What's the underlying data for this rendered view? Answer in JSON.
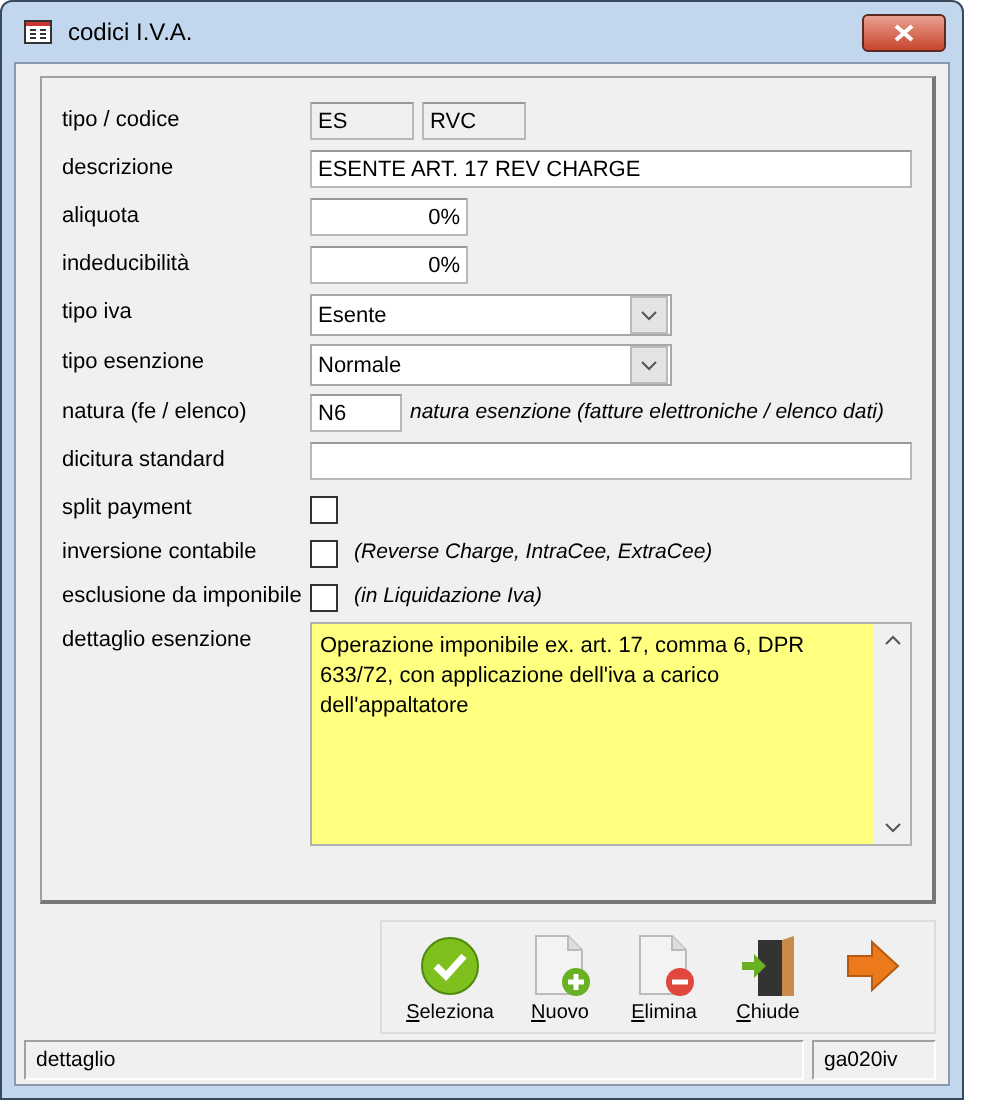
{
  "window": {
    "title": "codici I.V.A."
  },
  "fields": [
    {
      "kind": "pair",
      "label": "tipo / codice",
      "values": [
        "ES",
        "RVC"
      ]
    },
    {
      "kind": "text",
      "label": "descrizione",
      "value": "ESENTE ART. 17 REV CHARGE"
    },
    {
      "kind": "percent",
      "label": "aliquota",
      "value": "0%"
    },
    {
      "kind": "percent",
      "label": "indeducibilità",
      "value": "0%"
    },
    {
      "kind": "select",
      "label": "tipo iva",
      "value": "Esente"
    },
    {
      "kind": "select",
      "label": "tipo esenzione",
      "value": "Normale"
    },
    {
      "kind": "code",
      "label": "natura (fe / elenco)",
      "value": "N6",
      "note": "natura esenzione (fatture elettroniche / elenco dati)"
    },
    {
      "kind": "text",
      "label": "dicitura standard"
    },
    {
      "kind": "check",
      "label": "split payment",
      "checked": false
    },
    {
      "kind": "check",
      "label": "inversione contabile",
      "checked": false,
      "note": "(Reverse Charge, IntraCee, ExtraCee)"
    },
    {
      "kind": "check",
      "label": "esclusione da imponibile",
      "checked": false,
      "note": "(in Liquidazione Iva)"
    },
    {
      "kind": "memo",
      "label": "dettaglio esenzione",
      "value": "Operazione imponibile ex. art. 17, comma 6, DPR 633/72, con applicazione dell'iva a carico dell'appaltatore"
    }
  ],
  "toolbar": [
    {
      "kind": "check",
      "label": "Seleziona"
    },
    {
      "kind": "new",
      "label": "Nuovo"
    },
    {
      "kind": "delete",
      "label": "Elimina"
    },
    {
      "kind": "exit",
      "label": "Chiude"
    },
    {
      "kind": "next"
    }
  ],
  "status_bar": [
    "dettaglio",
    "ga020iv"
  ]
}
